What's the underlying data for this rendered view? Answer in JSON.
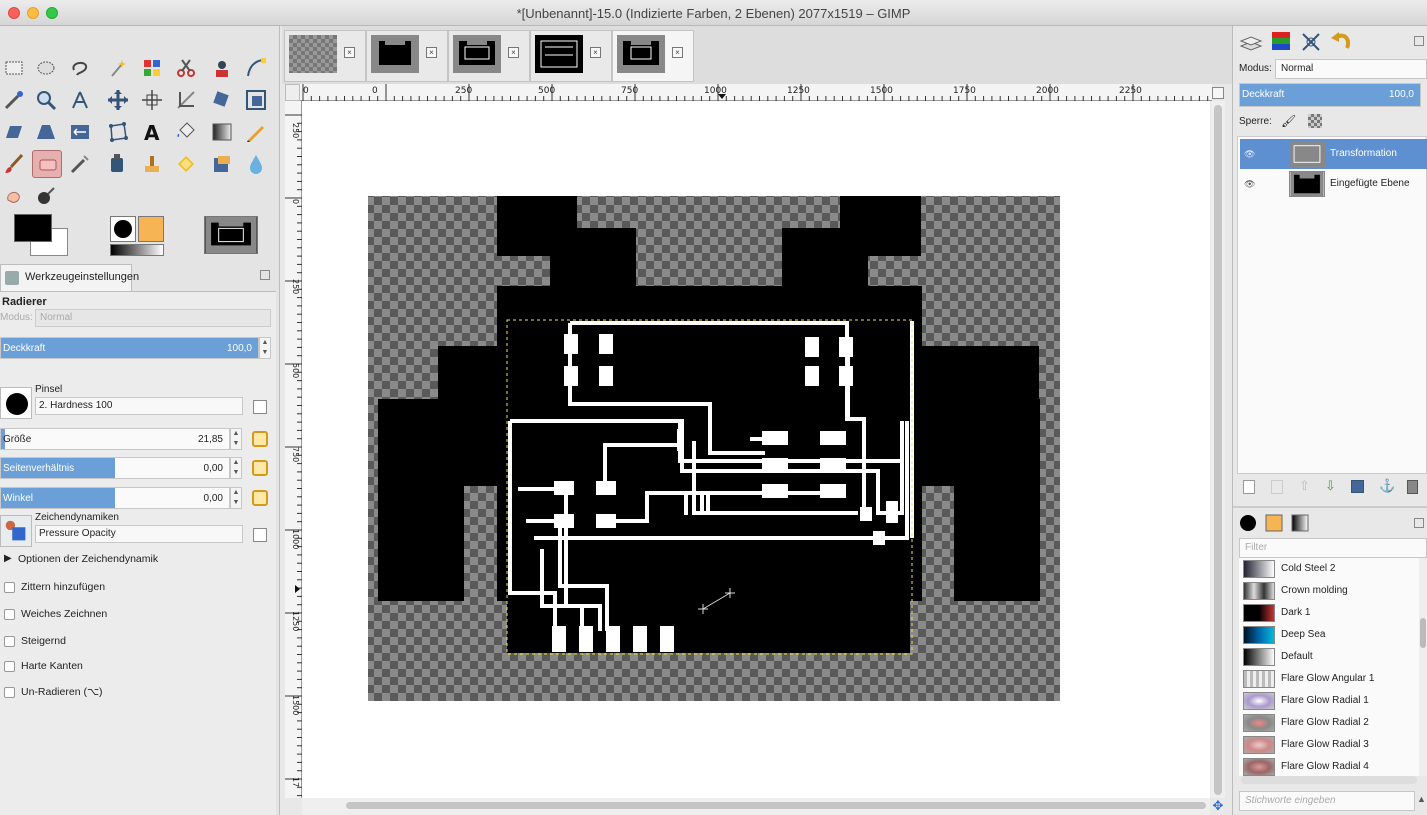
{
  "window": {
    "title": "*[Unbenannt]-15.0 (Indizierte Farben, 2 Ebenen) 2077x1519 – GIMP"
  },
  "tool_options": {
    "tab_label": "Werkzeugeinstellungen",
    "tool_name": "Radierer",
    "mode_label": "Modus:",
    "mode_value": "Normal",
    "opacity_label": "Deckkraft",
    "opacity_value": "100,0",
    "brush_label": "Pinsel",
    "brush_value": "2. Hardness 100",
    "size_label": "Größe",
    "size_value": "21,85",
    "aspect_label": "Seitenverhältnis",
    "aspect_value": "0,00",
    "angle_label": "Winkel",
    "angle_value": "0,00",
    "dynamics_label": "Zeichendynamiken",
    "dynamics_value": "Pressure Opacity",
    "dynamics_options": "Optionen der Zeichendynamik",
    "checkboxes": [
      "Zittern hinzufügen",
      "Weiches Zeichnen",
      "Steigernd",
      "Harte Kanten",
      "Un-Radieren (⌥)"
    ]
  },
  "rulers": {
    "h": [
      "0",
      "0",
      "250",
      "500",
      "750",
      "1000",
      "1250",
      "1500",
      "1750",
      "2000",
      "2250"
    ],
    "v": [
      "250",
      "0",
      "250",
      "500",
      "750",
      "1000",
      "1250",
      "1500",
      "17"
    ]
  },
  "layers": {
    "mode_label": "Modus:",
    "mode_value": "Normal",
    "opacity_label": "Deckkraft",
    "opacity_value": "100,0",
    "lock_label": "Sperre:",
    "items": [
      {
        "name": "Transformation",
        "selected": true
      },
      {
        "name": "Eingefügte Ebene",
        "selected": false
      }
    ]
  },
  "gradients": {
    "filter_placeholder": "Filter",
    "items": [
      "Cold Steel 2",
      "Crown molding",
      "Dark 1",
      "Deep Sea",
      "Default",
      "Flare Glow Angular 1",
      "Flare Glow Radial 1",
      "Flare Glow Radial 2",
      "Flare Glow Radial 3",
      "Flare Glow Radial 4"
    ],
    "tags_placeholder": "Stichworte eingeben"
  },
  "colors": {
    "accent": "#5d8fd1",
    "selection": "#f1e44a",
    "checker_dark": "#5a5a5a",
    "checker_light": "#8a8a8a"
  }
}
